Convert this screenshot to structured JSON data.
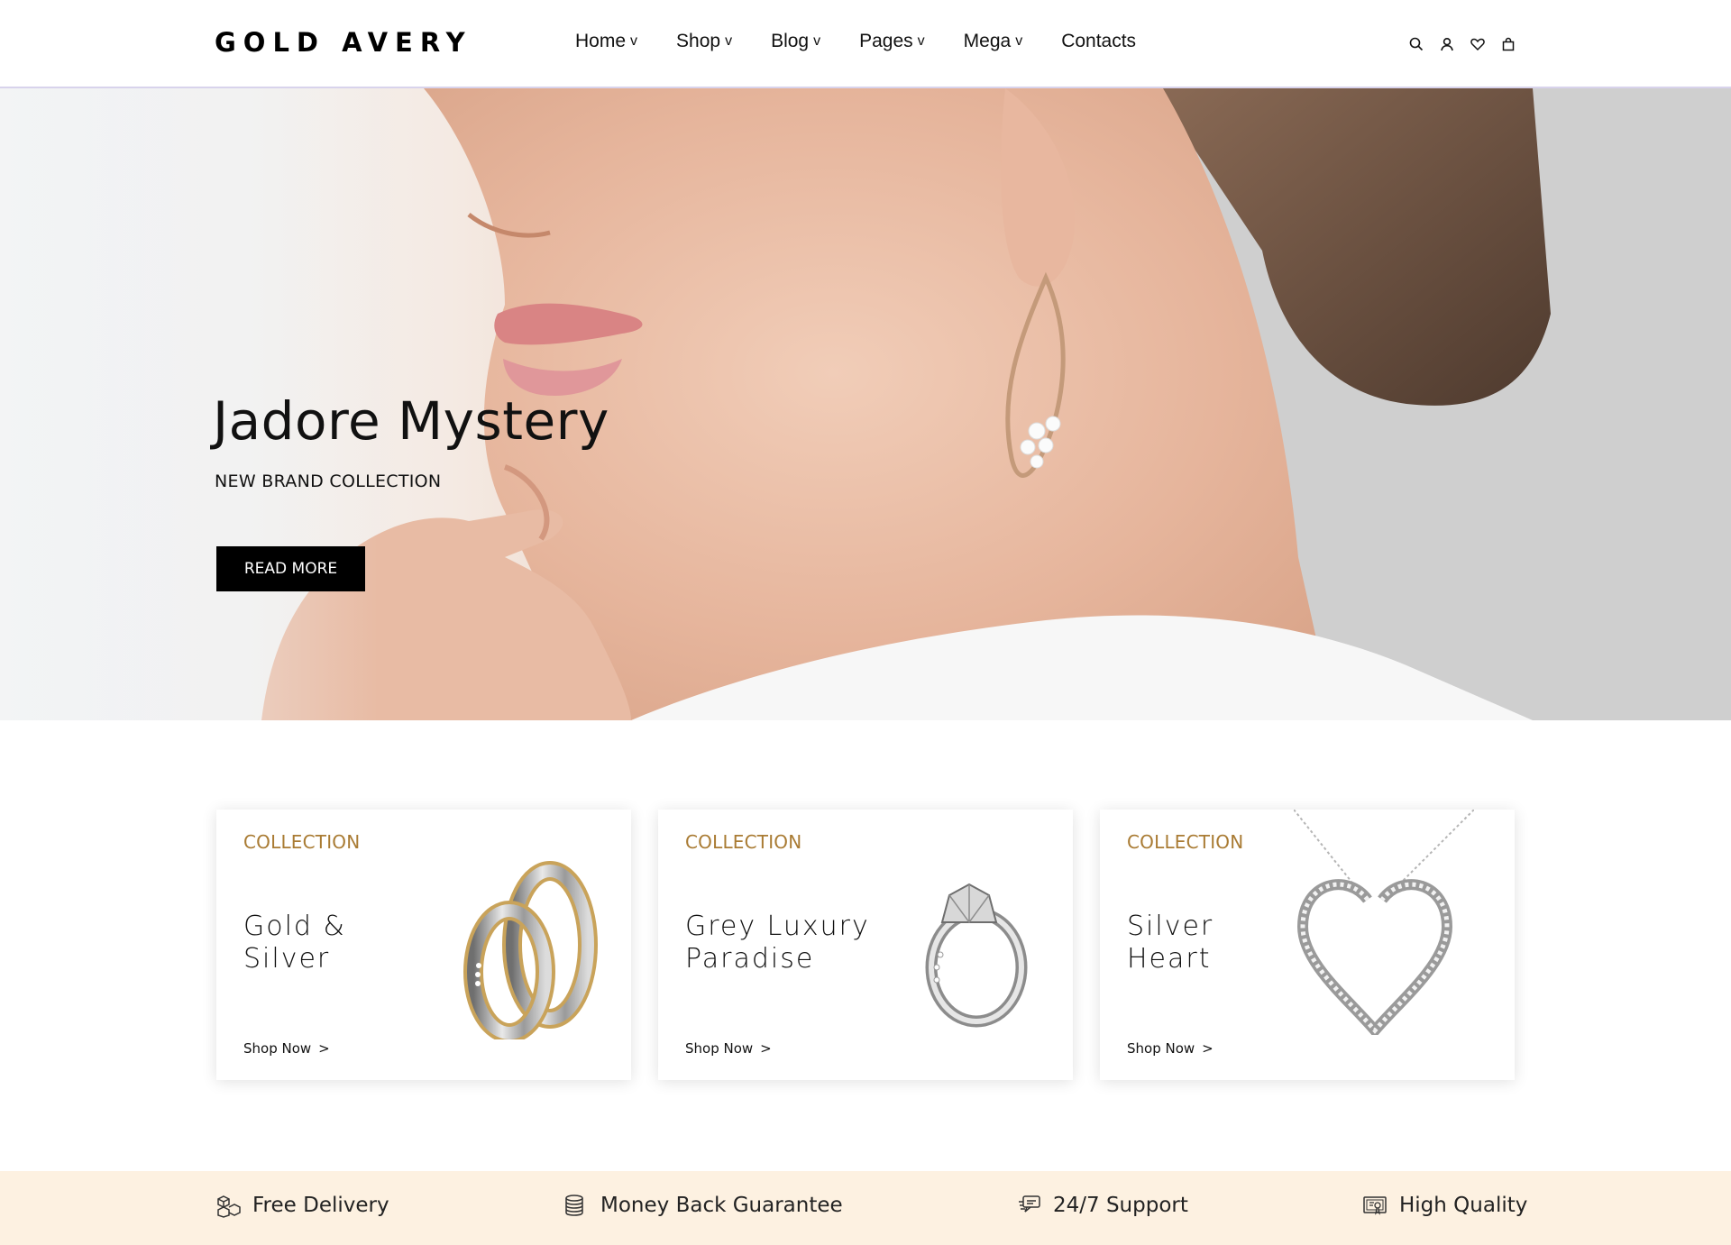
{
  "header": {
    "logo": "GOLD AVERY",
    "nav": [
      {
        "label": "Home",
        "dropdown": true
      },
      {
        "label": "Shop",
        "dropdown": true
      },
      {
        "label": "Blog",
        "dropdown": true
      },
      {
        "label": "Pages",
        "dropdown": true
      },
      {
        "label": "Mega",
        "dropdown": true
      },
      {
        "label": "Contacts",
        "dropdown": false
      }
    ],
    "caret": "v",
    "icons": [
      "search-icon",
      "user-icon",
      "heart-icon",
      "bag-icon"
    ]
  },
  "hero": {
    "title": "Jadore Mystery",
    "subtitle": "NEW BRAND COLLECTION",
    "button": "READ MORE"
  },
  "collections": [
    {
      "tag": "COLLECTION",
      "title_line1": "Gold &",
      "title_line2": "Silver",
      "link": "Shop Now",
      "image": "wedding-rings"
    },
    {
      "tag": "COLLECTION",
      "title_line1": "Grey Luxury",
      "title_line2": "Paradise",
      "link": "Shop Now",
      "image": "diamond-ring"
    },
    {
      "tag": "COLLECTION",
      "title_line1": "Silver",
      "title_line2": "Heart",
      "link": "Shop Now",
      "image": "heart-necklace"
    }
  ],
  "link_arrow": ">",
  "features": [
    {
      "label": "Free Delivery",
      "icon": "boxes-icon"
    },
    {
      "label": "Money Back Guarantee",
      "icon": "coins-icon"
    },
    {
      "label": "24/7 Support",
      "icon": "chat-icon"
    },
    {
      "label": "High Quality",
      "icon": "certificate-icon"
    }
  ],
  "colors": {
    "accent_gold": "#a97b33",
    "feature_bar": "#fdf1e1",
    "button_bg": "#000000"
  }
}
